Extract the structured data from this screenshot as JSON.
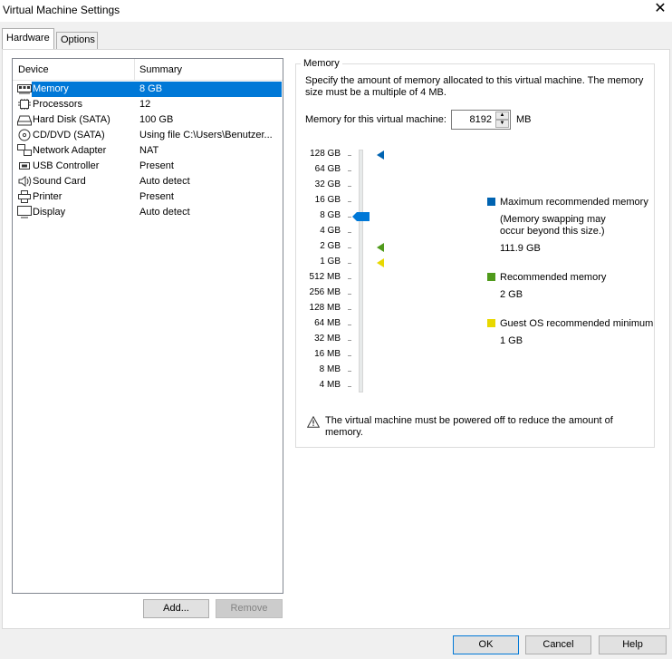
{
  "window": {
    "title": "Virtual Machine Settings",
    "close_glyph": "✕"
  },
  "tabs": [
    {
      "label": "Hardware"
    },
    {
      "label": "Options"
    }
  ],
  "device_list": {
    "columns": {
      "device": "Device",
      "summary": "Summary"
    },
    "rows": [
      {
        "name": "Memory",
        "summary": "8 GB",
        "icon": "memory-icon",
        "selected": true
      },
      {
        "name": "Processors",
        "summary": "12",
        "icon": "cpu-icon"
      },
      {
        "name": "Hard Disk (SATA)",
        "summary": "100 GB",
        "icon": "hard-disk-icon"
      },
      {
        "name": "CD/DVD (SATA)",
        "summary": "Using file C:\\Users\\Benutzer...",
        "icon": "cd-dvd-icon"
      },
      {
        "name": "Network Adapter",
        "summary": "NAT",
        "icon": "network-icon"
      },
      {
        "name": "USB Controller",
        "summary": "Present",
        "icon": "usb-icon"
      },
      {
        "name": "Sound Card",
        "summary": "Auto detect",
        "icon": "speaker-icon"
      },
      {
        "name": "Printer",
        "summary": "Present",
        "icon": "printer-icon"
      },
      {
        "name": "Display",
        "summary": "Auto detect",
        "icon": "monitor-icon"
      }
    ],
    "add_label": "Add...",
    "remove_label": "Remove"
  },
  "memory": {
    "group_title": "Memory",
    "description": "Specify the amount of memory allocated to this virtual machine. The memory size must be a multiple of 4 MB.",
    "field_label": "Memory for this virtual machine:",
    "value": "8192",
    "unit": "MB",
    "scale_labels": [
      "128 GB",
      "64 GB",
      "32 GB",
      "16 GB",
      "8 GB",
      "4 GB",
      "2 GB",
      "1 GB",
      "512 MB",
      "256 MB",
      "128 MB",
      "64 MB",
      "32 MB",
      "16 MB",
      "8 MB",
      "4 MB"
    ],
    "current": "8 GB",
    "max_marker": "128 GB",
    "recommended_marker": "2 GB",
    "minimum_marker": "1 GB",
    "legend": {
      "max_label": "Maximum recommended memory",
      "max_note": "(Memory swapping may occur beyond this size.)",
      "max_value": "111.9 GB",
      "rec_label": "Recommended memory",
      "rec_value": "2 GB",
      "min_label": "Guest OS recommended minimum",
      "min_value": "1 GB"
    },
    "warning": "The virtual machine must be powered off to reduce the amount of memory."
  },
  "colors": {
    "max": "#0063b1",
    "recommended": "#4f9a1b",
    "minimum": "#e8d800",
    "selection": "#0078d7"
  },
  "buttons": {
    "ok": "OK",
    "cancel": "Cancel",
    "help": "Help"
  }
}
